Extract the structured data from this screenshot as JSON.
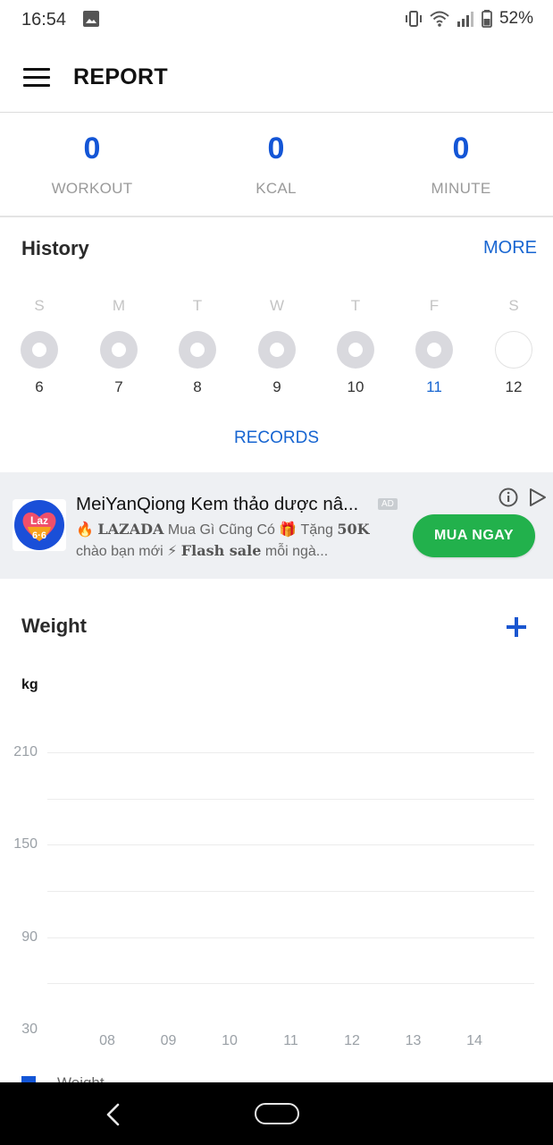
{
  "status_bar": {
    "time": "16:54",
    "battery": "52%",
    "icons": [
      "image-icon",
      "vibrate-icon",
      "wifi-icon",
      "signal-icon",
      "battery-icon"
    ]
  },
  "app_bar": {
    "title": "REPORT",
    "menu_icon": "hamburger-menu-icon"
  },
  "stats": [
    {
      "value": "0",
      "label": "WORKOUT"
    },
    {
      "value": "0",
      "label": "KCAL"
    },
    {
      "value": "0",
      "label": "MINUTE"
    }
  ],
  "history": {
    "title": "History",
    "more_label": "MORE",
    "records_label": "RECORDS",
    "days": [
      {
        "letter": "S",
        "date": "6",
        "state": "past"
      },
      {
        "letter": "M",
        "date": "7",
        "state": "past"
      },
      {
        "letter": "T",
        "date": "8",
        "state": "past"
      },
      {
        "letter": "W",
        "date": "9",
        "state": "past"
      },
      {
        "letter": "T",
        "date": "10",
        "state": "past"
      },
      {
        "letter": "F",
        "date": "11",
        "state": "today"
      },
      {
        "letter": "S",
        "date": "12",
        "state": "future"
      }
    ]
  },
  "ad": {
    "title": "MeiYanQiong Kem thảo dược nâ...",
    "badge": "AD",
    "line2_prefix": "🔥 ",
    "line2_brand": "LAZADA",
    "line2_mid": " Mua Gì Cũng Có  🎁 Tặng ",
    "line2_amount": "50K",
    "line3_prefix": "chào bạn mới ⚡ ",
    "line3_bold": "Flash sale",
    "line3_suffix": " mỗi ngà...",
    "cta_label": "MUA NGAY",
    "logo_text_top": "Laz",
    "logo_text_bottom": "6·6",
    "info_icon": "info-icon",
    "adchoices_icon": "adchoices-icon"
  },
  "weight": {
    "title": "Weight",
    "add_icon": "plus-icon",
    "unit_label": "kg",
    "legend_label": "Weight",
    "legend_color": "#1355d6"
  },
  "chart_data": {
    "type": "line",
    "title": "Weight",
    "xlabel": "",
    "ylabel": "kg",
    "categories": [
      "08",
      "09",
      "10",
      "11",
      "12",
      "13",
      "14"
    ],
    "y_ticks": [
      "210",
      "150",
      "90",
      "30"
    ],
    "ylim": [
      30,
      210
    ],
    "series": [
      {
        "name": "Weight",
        "values": []
      }
    ],
    "grid": true,
    "legend": "bottom-left"
  },
  "nav_bar": {
    "back_icon": "back-icon",
    "home_icon": "home-icon"
  },
  "colors": {
    "accent_blue": "#1765d1",
    "stat_blue": "#1355d6",
    "cta_green": "#22b14c"
  }
}
